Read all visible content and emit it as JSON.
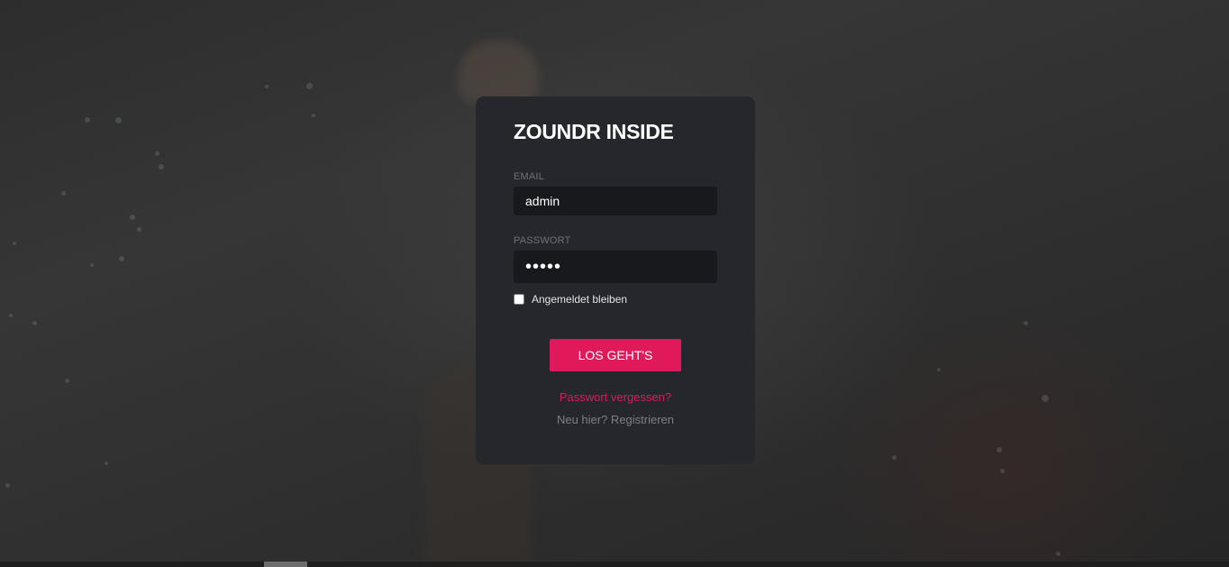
{
  "login": {
    "title": "ZOUNDR INSIDE",
    "email_label": "EMAIL",
    "email_value": "admin",
    "password_label": "PASSWORT",
    "password_value": "•••••",
    "remember_label": "Angemeldet bleiben",
    "remember_checked": false,
    "submit_label": "LOS GEHT'S",
    "forgot_link": "Passwort vergessen?",
    "register_link": "Neu hier? Registrieren"
  },
  "colors": {
    "accent": "#e0195a",
    "card_bg": "#26272c",
    "field_bg": "#18191d",
    "page_bg": "#2f2f2f"
  }
}
